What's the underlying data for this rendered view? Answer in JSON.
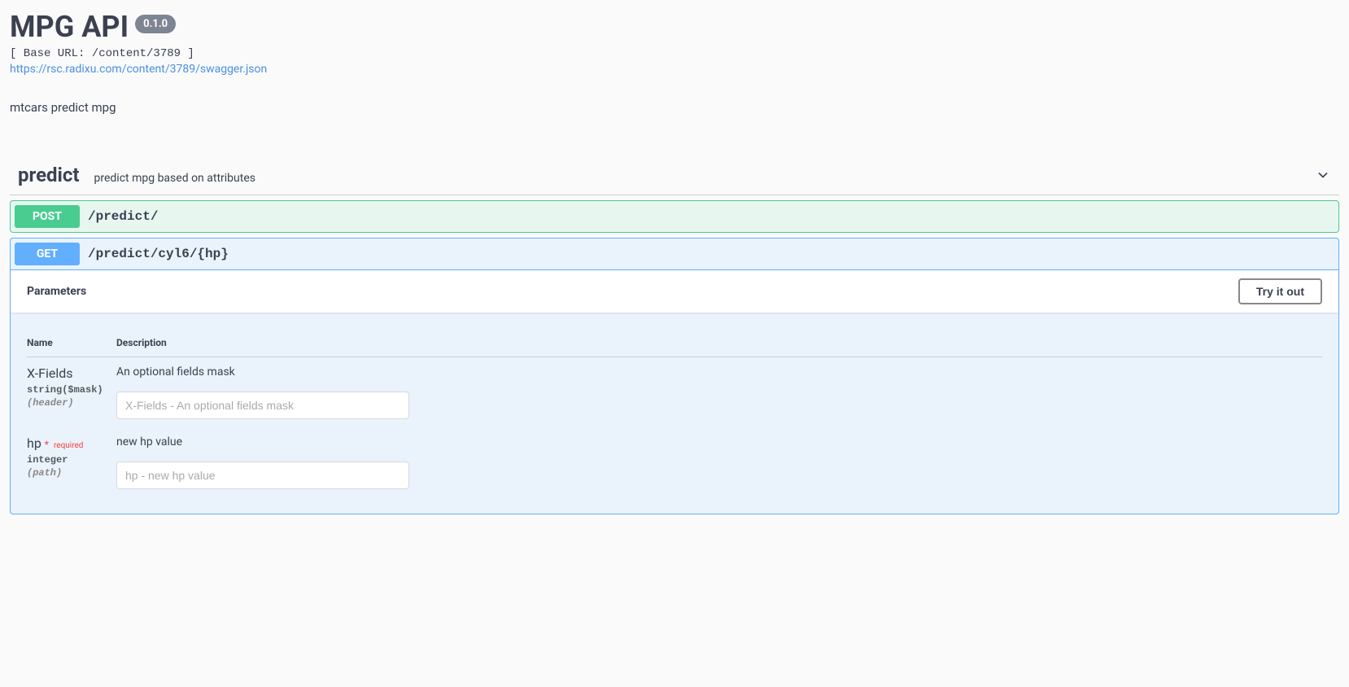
{
  "header": {
    "title": "MPG API",
    "version": "0.1.0",
    "base_url": "[ Base URL: /content/3789 ]",
    "swagger_url": "https://rsc.radixu.com/content/3789/swagger.json",
    "description": "mtcars predict mpg"
  },
  "section": {
    "name": "predict",
    "desc": "predict mpg based on attributes"
  },
  "operations": {
    "post": {
      "method": "POST",
      "path": "/predict/"
    },
    "get": {
      "method": "GET",
      "path": "/predict/cyl6/{hp}",
      "params_title": "Parameters",
      "try_label": "Try it out",
      "columns": {
        "name": "Name",
        "description": "Description"
      },
      "params": [
        {
          "name": "X-Fields",
          "type": "string($mask)",
          "in": "(header)",
          "required": false,
          "desc": "An optional fields mask",
          "placeholder": "X-Fields - An optional fields mask"
        },
        {
          "name": "hp",
          "type": "integer",
          "in": "(path)",
          "required": true,
          "required_text": "required",
          "desc": "new hp value",
          "placeholder": "hp - new hp value"
        }
      ]
    }
  }
}
